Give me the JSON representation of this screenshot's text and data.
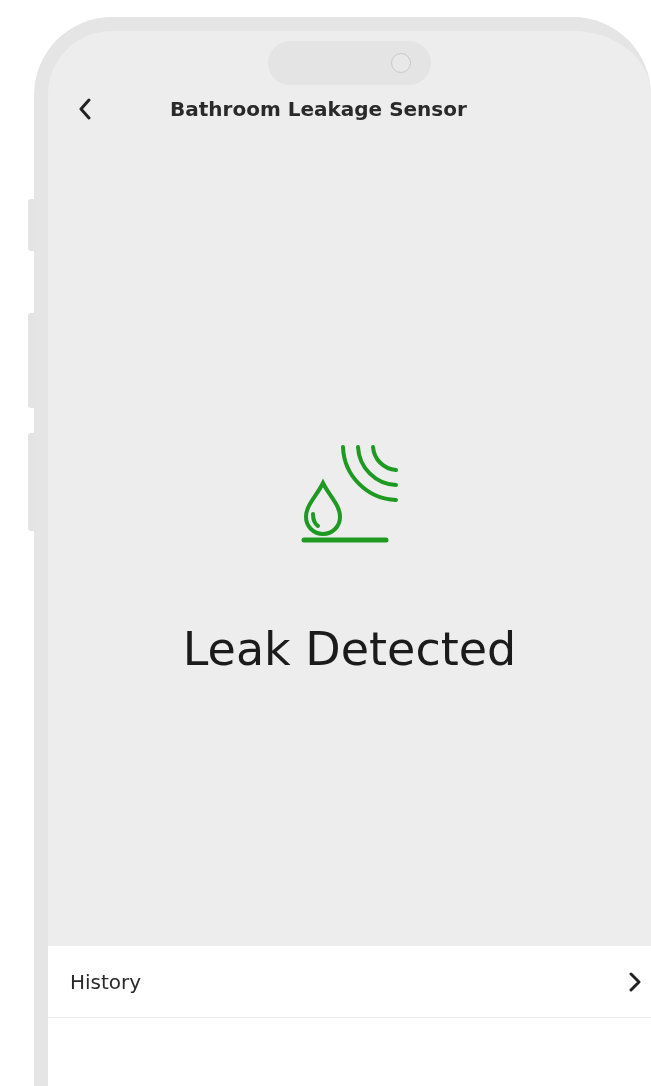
{
  "header": {
    "title": "Bathroom Leakage Sensor"
  },
  "status": {
    "text": "Leak Detected"
  },
  "menu": [
    {
      "label": "History"
    }
  ]
}
